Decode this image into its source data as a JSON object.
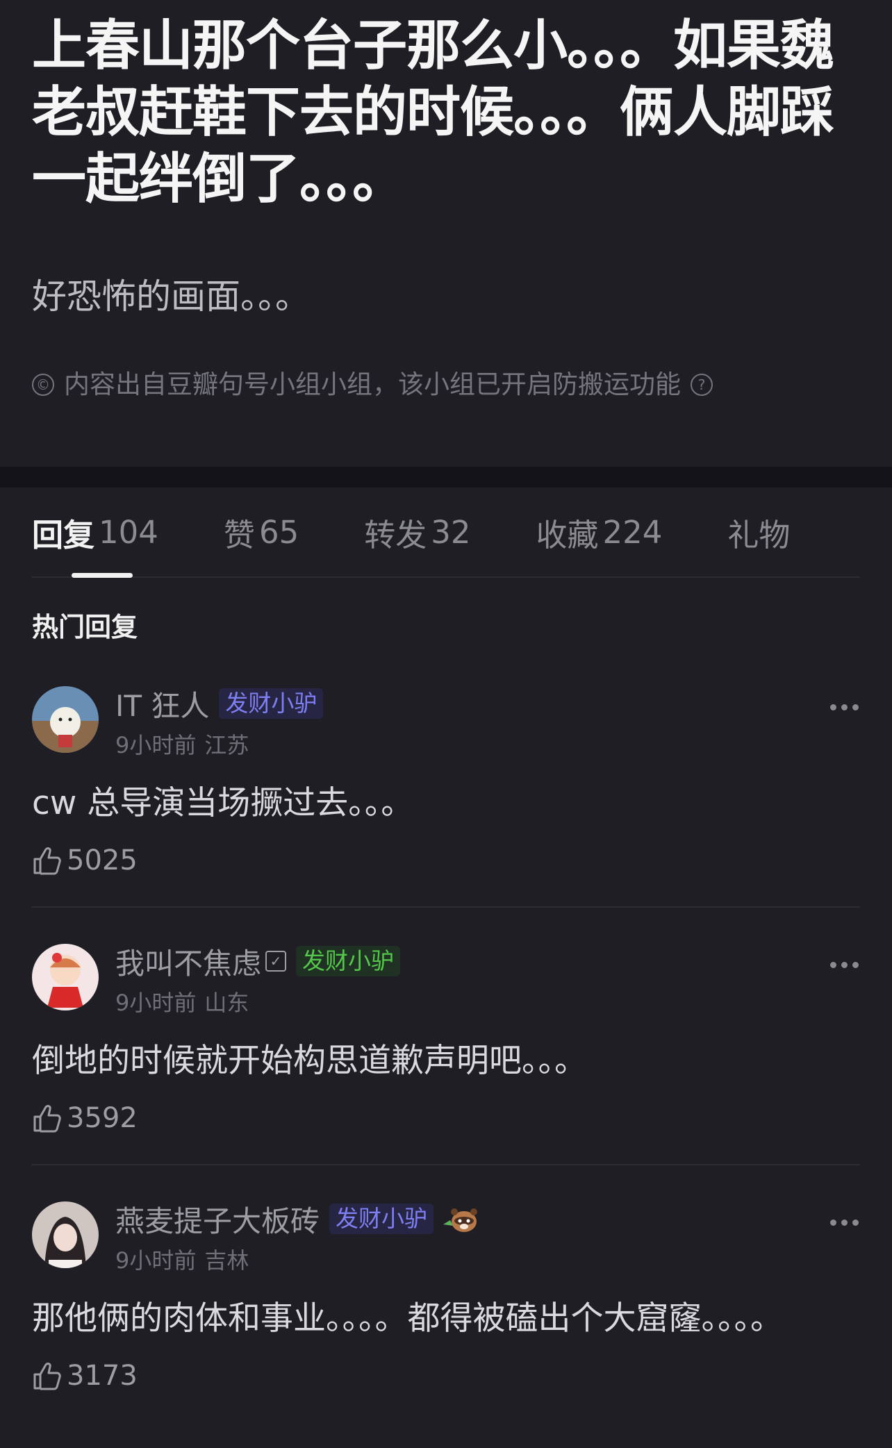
{
  "post": {
    "title": "上春山那个台子那么小。。。如果魏老叔赶鞋下去的时候。。。俩人脚踩一起绊倒了。。。",
    "body": "好恐怖的画面。。。",
    "copyright_notice": "内容出自豆瓣句号小组小组，该小组已开启防搬运功能"
  },
  "tabs": [
    {
      "label": "回复",
      "count": "104",
      "active": true
    },
    {
      "label": "赞",
      "count": "65"
    },
    {
      "label": "转发",
      "count": "32"
    },
    {
      "label": "收藏",
      "count": "224"
    },
    {
      "label": "礼物",
      "count": ""
    }
  ],
  "hot_heading": "热门回复",
  "comments": [
    {
      "username": "IT 狂人",
      "badge": "发财小驴",
      "time": "9小时前",
      "location": "江苏",
      "text": "cw 总导演当场撅过去。。。",
      "likes": "5025"
    },
    {
      "username": "我叫不焦虑",
      "badge": "发财小驴",
      "time": "9小时前",
      "location": "山东",
      "text": "倒地的时候就开始构思道歉声明吧。。。",
      "likes": "3592"
    },
    {
      "username": "燕麦提子大板砖",
      "badge": "发财小驴",
      "time": "9小时前",
      "location": "吉林",
      "text": "那他俩的肉体和事业。。。。都得被磕出个大窟窿。。。。",
      "likes": "3173"
    }
  ],
  "colors": {
    "background": "#1e1e24",
    "badge_blue": "#7f7ff4",
    "badge_green": "#55c74c"
  }
}
